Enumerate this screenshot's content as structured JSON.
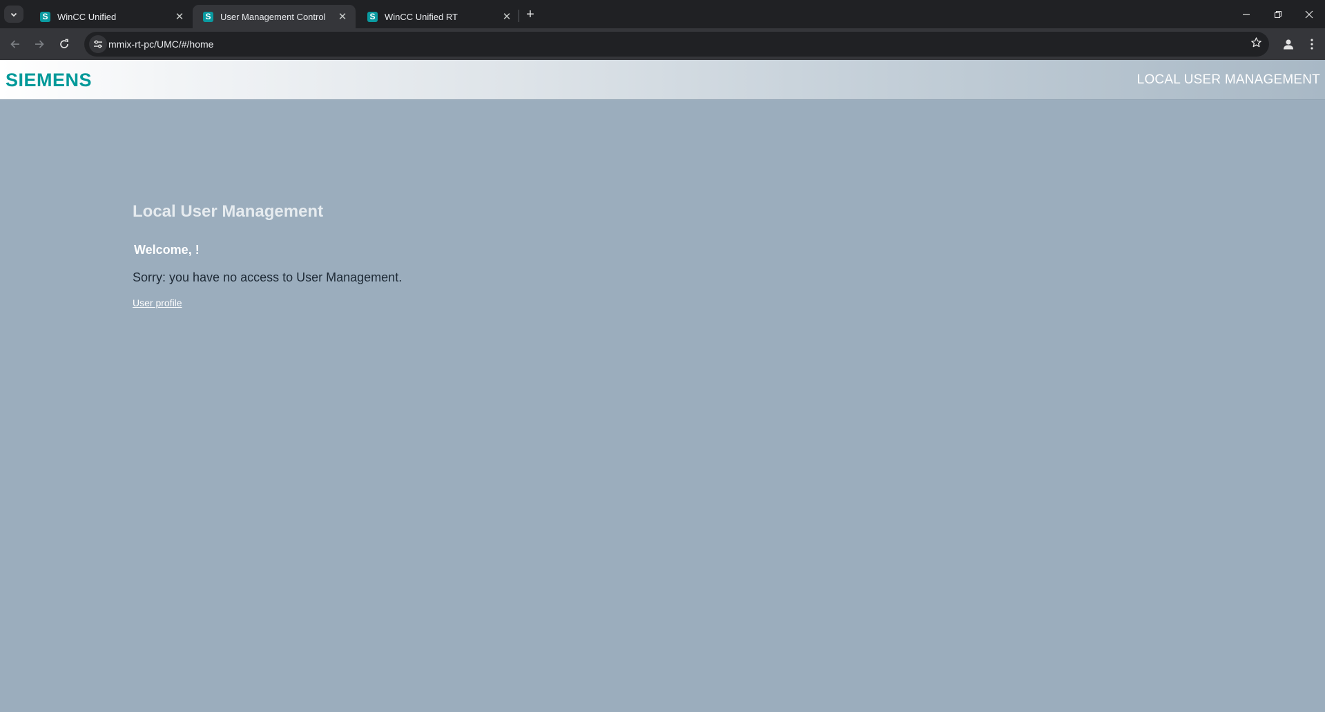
{
  "browser": {
    "tabs": [
      {
        "title": "WinCC Unified",
        "favicon": "S",
        "active": false
      },
      {
        "title": "User Management Control",
        "favicon": "S",
        "active": true
      },
      {
        "title": "WinCC Unified RT",
        "favicon": "S",
        "active": false
      }
    ],
    "url": "mmix-rt-pc/UMC/#/home",
    "icons": {
      "tab_search": "chevron-down-icon",
      "new_tab": "plus-icon",
      "back": "arrow-left-icon",
      "forward": "arrow-right-icon",
      "reload": "reload-icon",
      "site_info": "tune-icon",
      "bookmark": "star-icon",
      "profile": "person-icon",
      "menu": "kebab-icon"
    }
  },
  "header": {
    "logo": "SIEMENS",
    "title": "LOCAL USER MANAGEMENT",
    "logo_color": "#009999"
  },
  "main": {
    "heading": "Local User Management",
    "welcome": "Welcome, !",
    "message": "Sorry: you have no access to User Management.",
    "profile_link": "User profile"
  }
}
